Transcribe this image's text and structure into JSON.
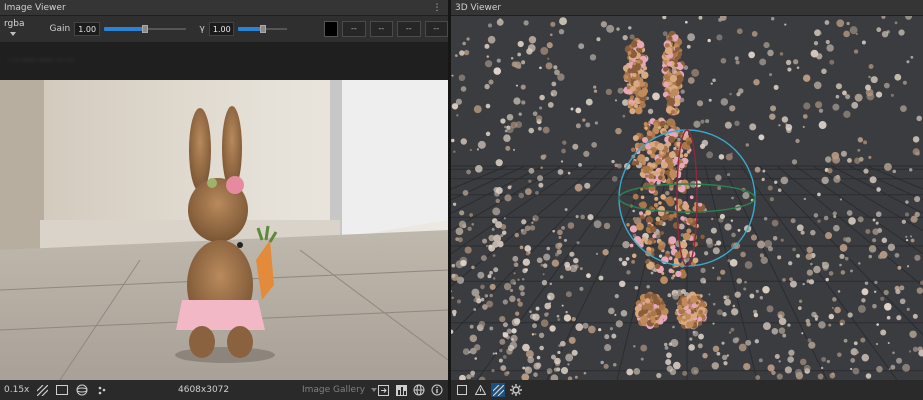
{
  "image_viewer": {
    "title": "Image Viewer",
    "menu_icon": "more-vertical-icon",
    "toolbar": {
      "channel": "rgba",
      "gain_label": "Gain",
      "gain_value": "1.00",
      "gain_level": 0.5,
      "gamma_label": "γ",
      "gamma_value": "1.00",
      "gamma_level": 0.5,
      "color_swatch": "#000000",
      "channel_values": [
        "--",
        "--",
        "--",
        "--"
      ]
    },
    "metadata_text": "· ·· ······ ······ ··· ···",
    "status": {
      "zoom": "0.15x",
      "resolution": "4608x3072",
      "gallery_label": "Image Gallery",
      "icons": [
        "hatch-icon",
        "frame-icon",
        "sphere-icon",
        "points-icon"
      ],
      "right_icons": [
        "export-icon",
        "histogram-icon",
        "globe-icon",
        "info-icon"
      ]
    }
  },
  "viewer_3d": {
    "title": "3D Viewer",
    "background": "#3a3c40",
    "toolbar_icons": [
      "square-icon",
      "warning-icon",
      "hatch-icon",
      "settings-icon"
    ]
  },
  "colors": {
    "accent": "#2a83d6",
    "panel": "#272727",
    "gizmo": "#3fa7c9"
  }
}
